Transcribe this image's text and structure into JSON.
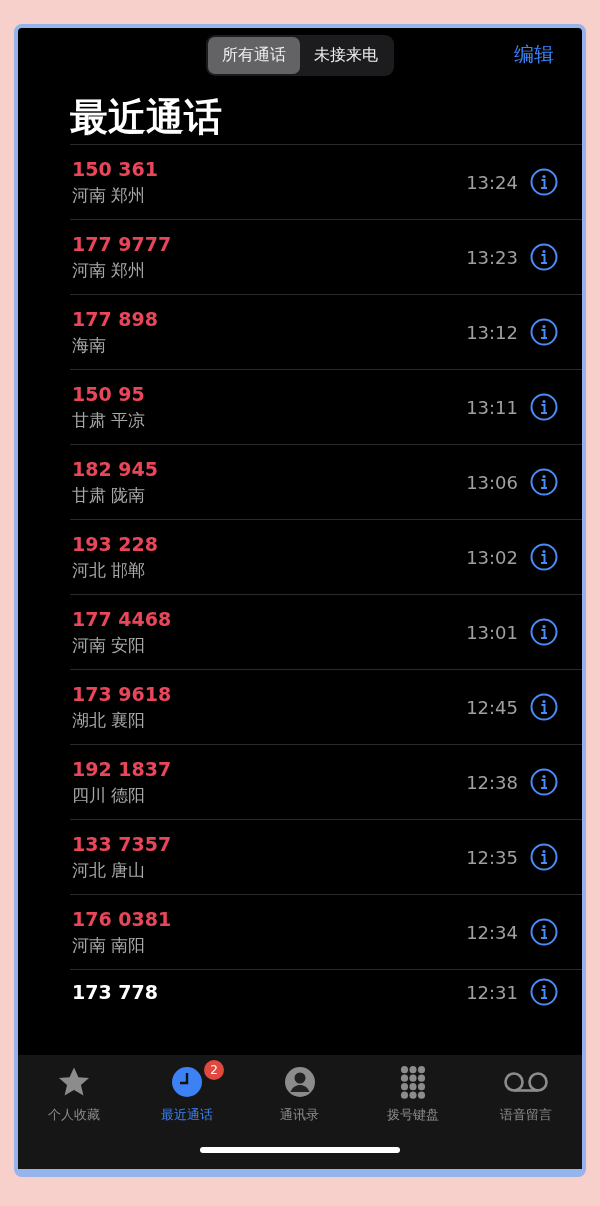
{
  "segments": [
    {
      "label": "所有通话",
      "selected": true
    },
    {
      "label": "未接来电",
      "selected": false
    }
  ],
  "edit_button": "编辑",
  "title": "最近通话",
  "calls": [
    {
      "number": "150 361",
      "location": "河南 郑州",
      "time": "13:24",
      "missed": true
    },
    {
      "number": "177 9777",
      "location": "河南 郑州",
      "time": "13:23",
      "missed": true
    },
    {
      "number": "177 898",
      "location": "海南",
      "time": "13:12",
      "missed": true
    },
    {
      "number": "150 95",
      "location": "甘肃 平凉",
      "time": "13:11",
      "missed": true
    },
    {
      "number": "182 945",
      "location": "甘肃 陇南",
      "time": "13:06",
      "missed": true
    },
    {
      "number": "193 228",
      "location": "河北 邯郸",
      "time": "13:02",
      "missed": true
    },
    {
      "number": "177 4468",
      "location": "河南 安阳",
      "time": "13:01",
      "missed": true
    },
    {
      "number": "173 9618",
      "location": "湖北 襄阳",
      "time": "12:45",
      "missed": true
    },
    {
      "number": "192 1837",
      "location": "四川 德阳",
      "time": "12:38",
      "missed": true
    },
    {
      "number": "133 7357",
      "location": "河北 唐山",
      "time": "12:35",
      "missed": true
    },
    {
      "number": "176 0381",
      "location": "河南 南阳",
      "time": "12:34",
      "missed": true
    },
    {
      "number": "173 778",
      "time": "12:31",
      "missed": false
    }
  ],
  "tabs": [
    {
      "kind": "favorites",
      "label": "个人收藏",
      "selected": false
    },
    {
      "kind": "recents",
      "label": "最近通话",
      "selected": true,
      "badge": "2"
    },
    {
      "kind": "contacts",
      "label": "通讯录",
      "selected": false
    },
    {
      "kind": "keypad",
      "label": "拨号键盘",
      "selected": false
    },
    {
      "kind": "voicemail",
      "label": "语音留言",
      "selected": false
    }
  ]
}
